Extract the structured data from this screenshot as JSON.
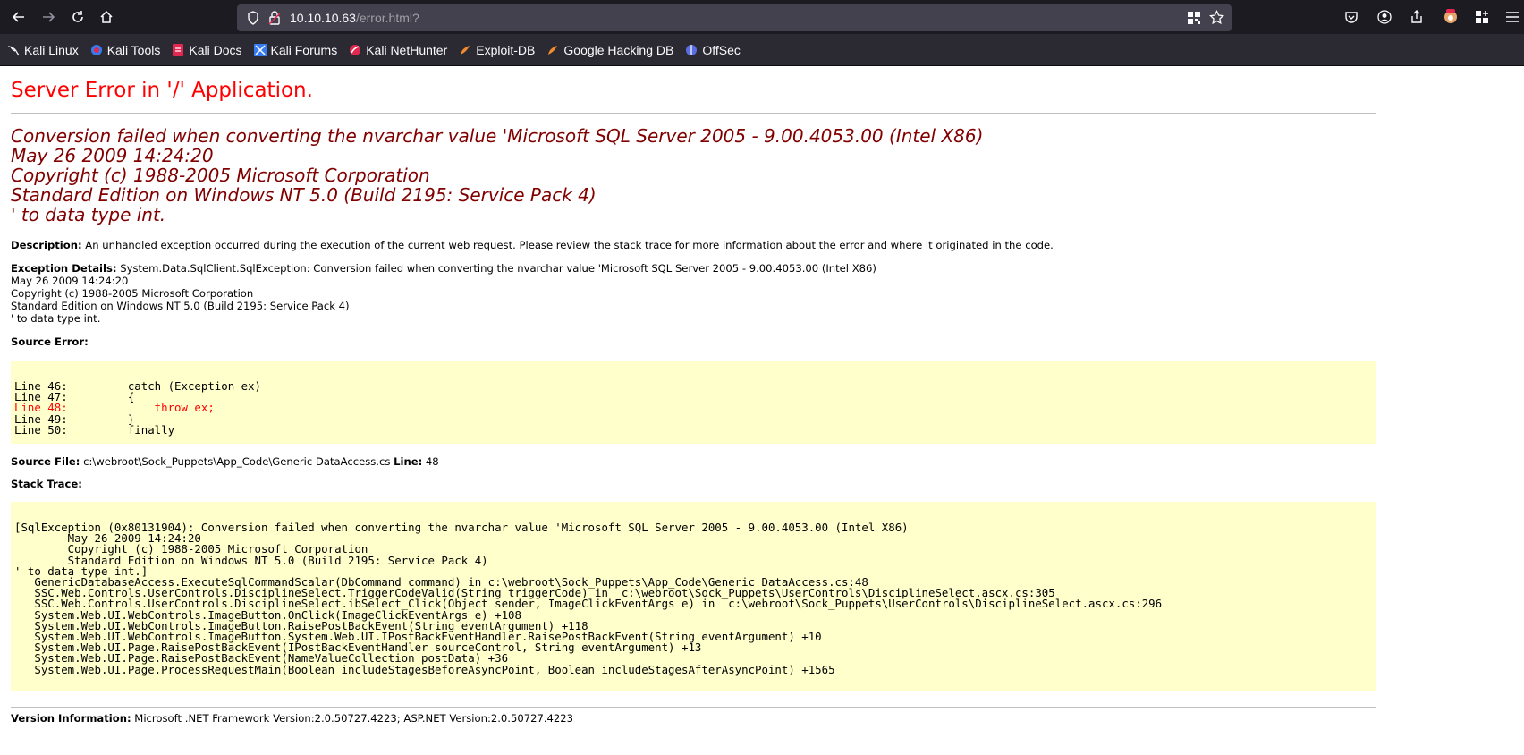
{
  "browser": {
    "url_host": "10.10.10.63",
    "url_path": "/error.html?",
    "bookmarks": [
      "Kali Linux",
      "Kali Tools",
      "Kali Docs",
      "Kali Forums",
      "Kali NetHunter",
      "Exploit-DB",
      "Google Hacking DB",
      "OffSec"
    ]
  },
  "page": {
    "title": "Server Error in '/' Application.",
    "error_heading": [
      "Conversion failed when converting the nvarchar value 'Microsoft SQL Server 2005 - 9.00.4053.00 (Intel X86)",
      "May 26 2009 14:24:20",
      "Copyright (c) 1988-2005 Microsoft Corporation",
      "Standard Edition on Windows NT 5.0 (Build 2195: Service Pack 4)",
      "' to data type int."
    ],
    "description_label": "Description:",
    "description_text": " An unhandled exception occurred during the execution of the current web request. Please review the stack trace for more information about the error and where it originated in the code.",
    "exception_label": "Exception Details:",
    "exception_lines": [
      " System.Data.SqlClient.SqlException: Conversion failed when converting the nvarchar value 'Microsoft SQL Server 2005 - 9.00.4053.00 (Intel X86)",
      "May 26 2009 14:24:20",
      "Copyright (c) 1988-2005 Microsoft Corporation",
      "Standard Edition on Windows NT 5.0 (Build 2195: Service Pack 4)",
      "' to data type int."
    ],
    "source_error_label": "Source Error:",
    "source_lines": [
      "Line 46:         catch (Exception ex)",
      "Line 47:         {",
      "Line 48:             throw ex;",
      "Line 49:         }",
      "Line 50:         finally"
    ],
    "source_file_label": "Source File:",
    "source_file": " c:\\webroot\\Sock_Puppets\\App_Code\\Generic DataAccess.cs ",
    "line_label": "Line:",
    "line_value": " 48",
    "stack_trace_label": "Stack Trace:",
    "stack_lines": [
      "[SqlException (0x80131904): Conversion failed when converting the nvarchar value 'Microsoft SQL Server 2005 - 9.00.4053.00 (Intel X86)",
      "        May 26 2009 14:24:20",
      "        Copyright (c) 1988-2005 Microsoft Corporation",
      "        Standard Edition on Windows NT 5.0 (Build 2195: Service Pack 4)",
      "' to data type int.]",
      "   GenericDatabaseAccess.ExecuteSqlCommandScalar(DbCommand command) in c:\\webroot\\Sock_Puppets\\App_Code\\Generic DataAccess.cs:48",
      "   SSC.Web.Controls.UserControls.DisciplineSelect.TriggerCodeValid(String triggerCode) in  c:\\webroot\\Sock_Puppets\\UserControls\\DisciplineSelect.ascx.cs:305",
      "   SSC.Web.Controls.UserControls.DisciplineSelect.ibSelect_Click(Object sender, ImageClickEventArgs e) in  c:\\webroot\\Sock_Puppets\\UserControls\\DisciplineSelect.ascx.cs:296",
      "   System.Web.UI.WebControls.ImageButton.OnClick(ImageClickEventArgs e) +108",
      "   System.Web.UI.WebControls.ImageButton.RaisePostBackEvent(String eventArgument) +118",
      "   System.Web.UI.WebControls.ImageButton.System.Web.UI.IPostBackEventHandler.RaisePostBackEvent(String eventArgument) +10",
      "   System.Web.UI.Page.RaisePostBackEvent(IPostBackEventHandler sourceControl, String eventArgument) +13",
      "   System.Web.UI.Page.RaisePostBackEvent(NameValueCollection postData) +36",
      "   System.Web.UI.Page.ProcessRequestMain(Boolean includeStagesBeforeAsyncPoint, Boolean includeStagesAfterAsyncPoint) +1565"
    ],
    "version_label": "Version Information:",
    "version_text": " Microsoft .NET Framework Version:2.0.50727.4223; ASP.NET Version:2.0.50727.4223"
  },
  "colors": {
    "title": "#ff0000",
    "heading": "#800000",
    "codebox": "#ffffcc"
  }
}
